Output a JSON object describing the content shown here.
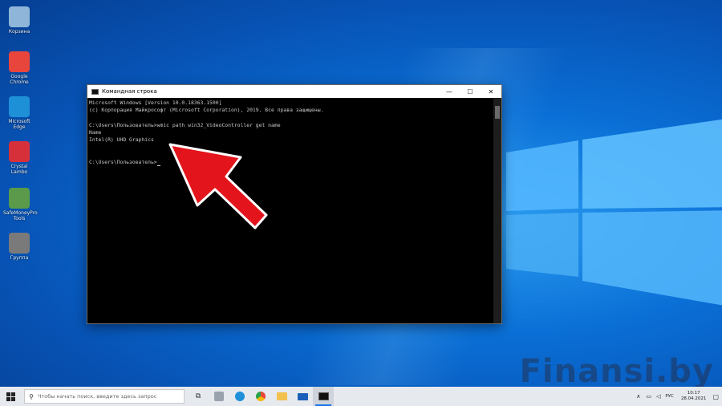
{
  "desktop_icons": [
    {
      "label": "Корзина",
      "color": "#8fb6d8"
    },
    {
      "label": "Google Chrome",
      "color": "#e8453c"
    },
    {
      "label": "Microsoft Edge",
      "color": "#1e90d8"
    },
    {
      "label": "Crystal Lambo",
      "color": "#d6303a"
    },
    {
      "label": "SafeMoneyPro Tools",
      "color": "#5a9a4a"
    },
    {
      "label": "Группа",
      "color": "#7a7a7a"
    }
  ],
  "cmd": {
    "title": "Командная строка",
    "lines": [
      "Microsoft Windows [Version 10.0.18363.1500]",
      "(c) Корпорация Майкрософт (Microsoft Corporation), 2019. Все права защищены.",
      "",
      "C:\\Users\\Пользователь>wmic path win32_VideoController get name",
      "Name",
      "Intel(R) UHD Graphics",
      "",
      "",
      "C:\\Users\\Пользователь>"
    ],
    "minimize": "—",
    "maximize": "☐",
    "close": "✕"
  },
  "watermark": "Finansi.by",
  "taskbar": {
    "search_placeholder": "Чтобы начать поиск, введите здесь запрос",
    "lang": "РУС",
    "time": "10:17",
    "date": "28.04.2021"
  },
  "colors": {
    "arrow": "#e3141b",
    "taskbar": "#e6e9ee",
    "accent": "#1a73e8"
  }
}
